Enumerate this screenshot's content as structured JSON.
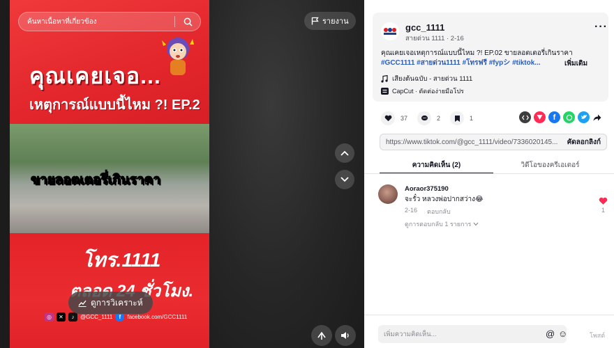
{
  "search": {
    "placeholder": "ค้นหาเนื้อหาที่เกี่ยวข้อง"
  },
  "video": {
    "headline1": "คุณเคยเจอ...",
    "headline2": "เหตุการณ์แบบนี้ไหม ?! EP.2",
    "overlay_caption": "ขายลอตเตอรี่เกินราคา",
    "hotline": "โทร.1111",
    "hotline_hours": "ตลอด 24 ชั่วโมง.",
    "social_handle": "@GCC_1111",
    "facebook": "facebook.com/GCC1111",
    "report_label": "รายงาน",
    "analytics_label": "ดูการวิเคราะห์"
  },
  "post": {
    "author": "gcc_1111",
    "meta": "สายด่วน 1111 · 2-16",
    "description": "คุณเคยเจอเหตุการณ์แบบนี้ไหม ?! EP.02 ขายลอตเตอรี่เกินราคา",
    "tags": "#GCC1111 #สายด่วน1111 #โทรฟรี #fypシ #tiktok...",
    "more_label": "เพิ่มเติม",
    "music": "เสียงต้นฉบับ - สายด่วน 1111",
    "capcut": "CapCut · ตัดต่อง่ายมือโปร",
    "likes": "37",
    "comments": "2",
    "saves": "1"
  },
  "link": {
    "url": "https://www.tiktok.com/@gcc_1111/video/7336020145...",
    "copy_label": "คัดลอกลิงก์"
  },
  "tabs": [
    {
      "label": "ความคิดเห็น (2)"
    },
    {
      "label": "วิดีโอของครีเอเตอร์"
    }
  ],
  "comment": {
    "user": "Aoraor375190",
    "text": "จะรั๋ว หลวงพ่อปากสว่าง😂",
    "date": "2-16",
    "reply_label": "ตอบกลับ",
    "view_replies": "ดูการตอบกลับ 1 รายการ",
    "likes": "1"
  },
  "comment_bar": {
    "placeholder": "เพิ่มความคิดเห็น...",
    "post_label": "โพสต์"
  },
  "colors": {
    "brand_red": "#e3262a",
    "like_red": "#fe2c55",
    "link_blue": "#2b5db9"
  }
}
